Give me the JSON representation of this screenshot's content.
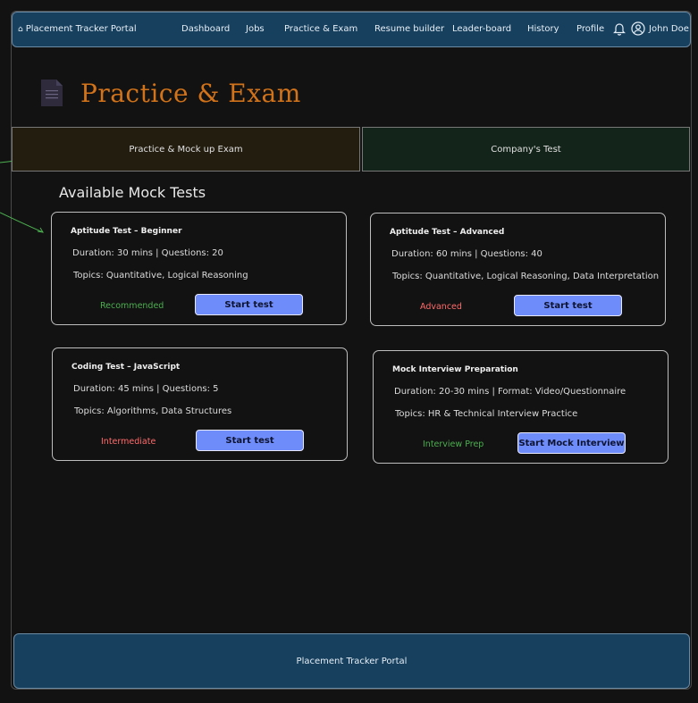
{
  "navbar": {
    "brand": "Placement Tracker Portal",
    "items": [
      "Dashboard",
      "Jobs",
      "Practice & Exam",
      "Resume builder",
      "Leader-board",
      "History",
      "Profile"
    ],
    "user_name": "John Doe"
  },
  "page": {
    "title": "Practice & Exam"
  },
  "tabs": {
    "practice": "Practice & Mock up Exam",
    "company": "Company's Test"
  },
  "section": {
    "title": "Available Mock Tests"
  },
  "cards": [
    {
      "title": "Aptitude Test – Beginner",
      "duration": "Duration: 30 mins | Questions: 20",
      "topics": "Topics: Quantitative, Logical Reasoning",
      "tag": "Recommended",
      "tag_color": "#4caf50",
      "button": "Start test"
    },
    {
      "title": "Aptitude Test – Advanced",
      "duration": "Duration: 60 mins | Questions: 40",
      "topics": "Topics: Quantitative, Logical Reasoning, Data Interpretation",
      "tag": "Advanced",
      "tag_color": "#ff6b6b",
      "button": "Start test"
    },
    {
      "title": "Coding Test – JavaScript",
      "duration": "Duration: 45 mins | Questions: 5",
      "topics": "Topics: Algorithms, Data Structures",
      "tag": "Intermediate",
      "tag_color": "#ff6b6b",
      "button": "Start test"
    },
    {
      "title": "Mock Interview Preparation",
      "duration": "Duration: 20-30 mins | Format: Video/Questionnaire",
      "topics": "Topics: HR & Technical Interview Practice",
      "tag": "Interview Prep",
      "tag_color": "#4caf50",
      "button": "Start Mock Interview"
    }
  ],
  "footer": {
    "text": "Placement Tracker Portal"
  },
  "colors": {
    "navbar_bg": "#17405f",
    "title_accent": "#d2731a",
    "button_bg": "#6f8dfa"
  }
}
